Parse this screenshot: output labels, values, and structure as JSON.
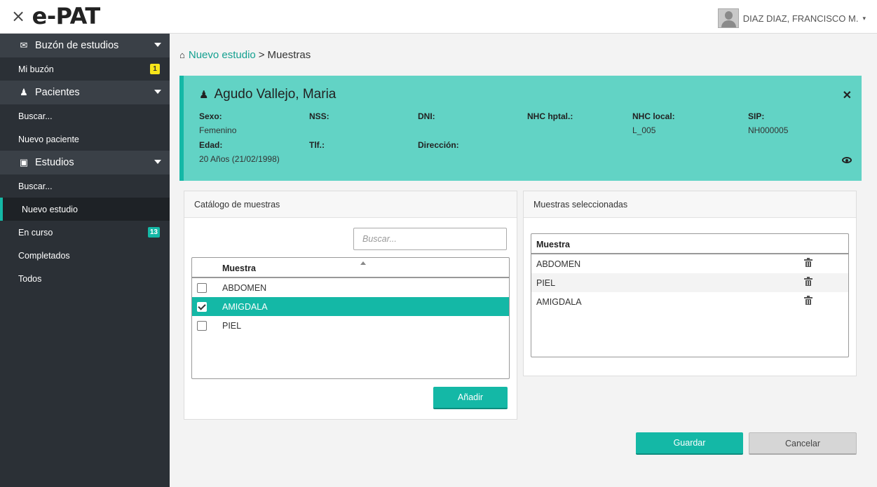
{
  "app": {
    "logo": "e-PAT",
    "close_glyph": "×"
  },
  "user": {
    "name": "DIAZ DIAZ, FRANCISCO M.",
    "caret": "▾"
  },
  "sidebar": {
    "sections": [
      {
        "label": "Buzón de estudios",
        "icon": "envelope-icon"
      },
      {
        "label": "Pacientes",
        "icon": "person-icon"
      },
      {
        "label": "Estudios",
        "icon": "folder-icon"
      }
    ],
    "items": {
      "mi_buzon": {
        "label": "Mi buzón",
        "badge": "1"
      },
      "buscar_pacientes": {
        "label": "Buscar..."
      },
      "nuevo_paciente": {
        "label": "Nuevo paciente"
      },
      "buscar_estudios": {
        "label": "Buscar..."
      },
      "nuevo_estudio": {
        "label": "Nuevo estudio"
      },
      "en_curso": {
        "label": "En curso",
        "badge": "13"
      },
      "completados": {
        "label": "Completados"
      },
      "todos": {
        "label": "Todos"
      }
    }
  },
  "breadcrumb": {
    "link": "Nuevo estudio",
    "separator": ">",
    "current": "Muestras"
  },
  "patient": {
    "name": "Agudo Vallejo, Maria",
    "fields": {
      "sexo": {
        "label": "Sexo:",
        "value": "Femenino"
      },
      "nss": {
        "label": "NSS:",
        "value": ""
      },
      "dni": {
        "label": "DNI:",
        "value": ""
      },
      "nhc_hptal": {
        "label": "NHC hptal.:",
        "value": ""
      },
      "nhc_local": {
        "label": "NHC local:",
        "value": "L_005"
      },
      "sip": {
        "label": "SIP:",
        "value": "NH000005"
      },
      "edad": {
        "label": "Edad:",
        "value": "20 Años (21/02/1998)"
      },
      "tlf": {
        "label": "Tlf.:",
        "value": ""
      },
      "direccion": {
        "label": "Dirección:",
        "value": ""
      }
    }
  },
  "catalog": {
    "title": "Catálogo de muestras",
    "search_placeholder": "Buscar...",
    "column": "Muestra",
    "rows": [
      {
        "label": "ABDOMEN",
        "checked": false
      },
      {
        "label": "AMIGDALA",
        "checked": true
      },
      {
        "label": "PIEL",
        "checked": false
      }
    ],
    "add_button": "Añadir"
  },
  "selected": {
    "title": "Muestras seleccionadas",
    "column": "Muestra",
    "rows": [
      "ABDOMEN",
      "PIEL",
      "AMIGDALA"
    ]
  },
  "actions": {
    "save": "Guardar",
    "cancel": "Cancelar"
  },
  "colors": {
    "accent": "#14b8a6",
    "patient_bg": "#62d3c5",
    "sidebar_bg": "#2b3036",
    "badge_yellow": "#f6e519"
  }
}
